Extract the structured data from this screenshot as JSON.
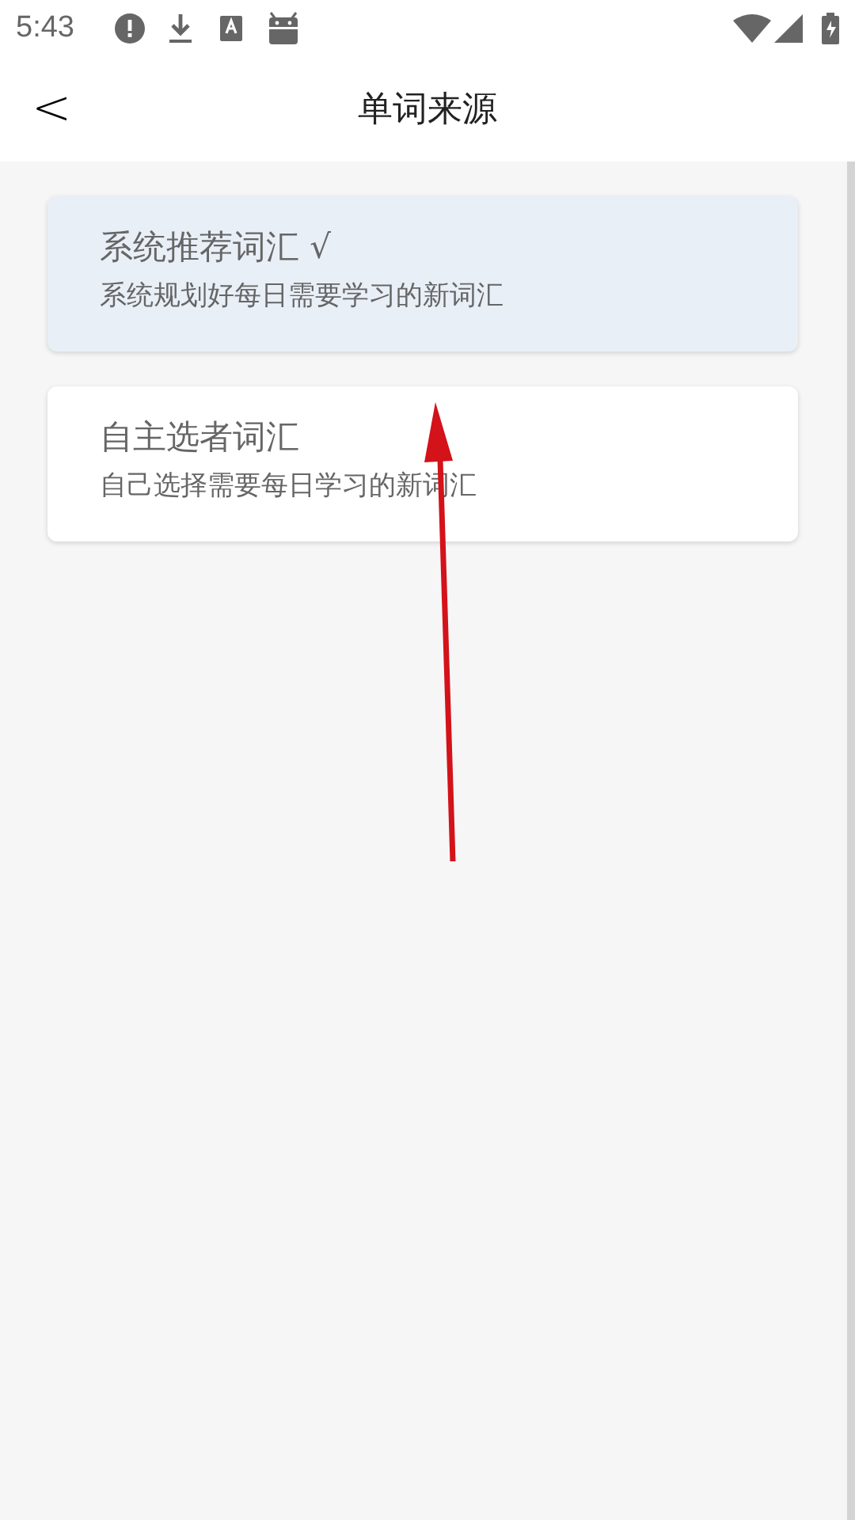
{
  "status_bar": {
    "time": "5:43"
  },
  "header": {
    "back": "<",
    "title": "单词来源"
  },
  "options": [
    {
      "title": "系统推荐词汇 √",
      "description": "系统规划好每日需要学习的新词汇",
      "selected": true
    },
    {
      "title": "自主选者词汇",
      "description": "自己选择需要每日学习的新词汇",
      "selected": false
    }
  ]
}
